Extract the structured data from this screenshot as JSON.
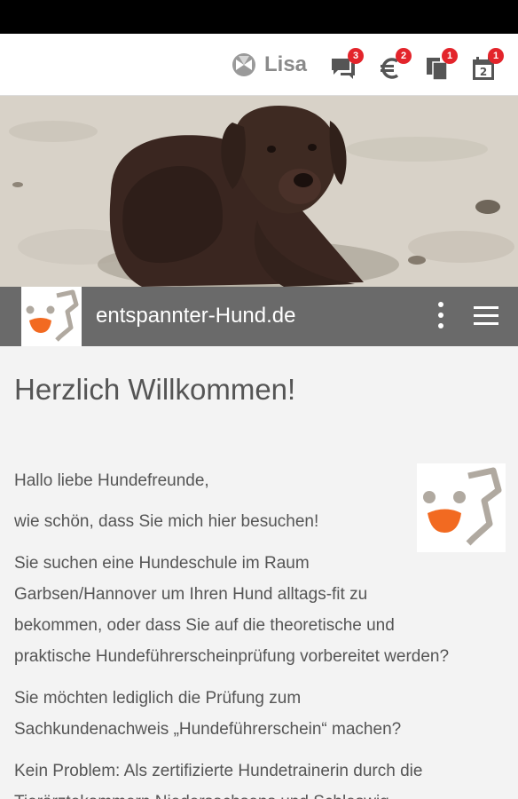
{
  "topbar": {
    "user_name": "Lisa",
    "icons": [
      {
        "name": "chat-icon",
        "badge": "3"
      },
      {
        "name": "euro-icon",
        "badge": "2"
      },
      {
        "name": "documents-icon",
        "badge": "1"
      },
      {
        "name": "calendar-icon",
        "badge": "1"
      }
    ]
  },
  "brand": {
    "title": "entspannter-Hund.de"
  },
  "content": {
    "heading": "Herzlich Willkommen!",
    "paragraphs": [
      "Hallo liebe Hundefreunde,",
      "wie schön, dass Sie mich hier besuchen!",
      "Sie suchen eine Hundeschule im Raum",
      "Garbsen/Hannover um Ihren Hund alltags-fit zu",
      "bekommen, oder dass Sie auf die theoretische und",
      "praktische Hundeführerscheinprüfung vorbereitet werden?",
      "Sie möchten lediglich die Prüfung zum",
      "Sachkundenachweis „Hundeführerschein“ machen?",
      "Kein Problem: Als zertifizierte Hundetrainerin durch die",
      "Tierärztekammern Niedersachsens und Schleswig-"
    ]
  },
  "colors": {
    "badge": "#e3242b",
    "brandbar": "#6a6a6a",
    "logo_orange": "#f26a21",
    "logo_gray": "#b0a9a0"
  }
}
